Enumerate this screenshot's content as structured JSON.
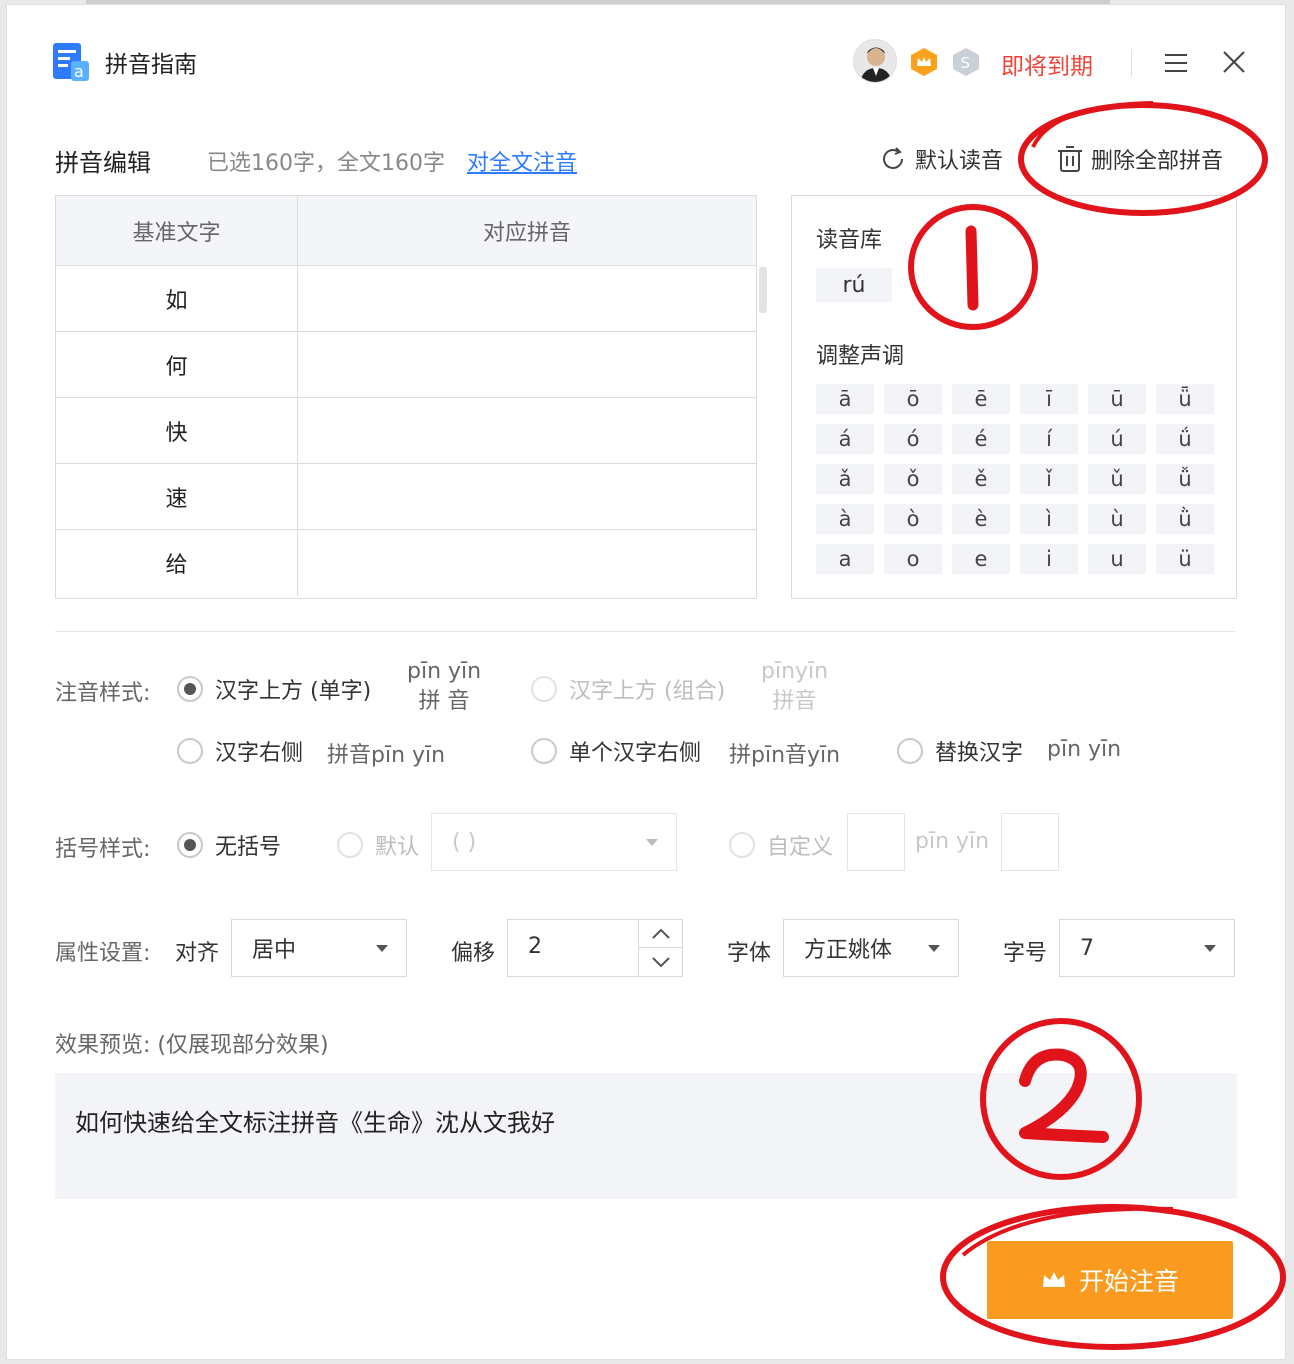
{
  "app": {
    "title": "拼音指南"
  },
  "header": {
    "expire_label": "即将到期"
  },
  "editor": {
    "title": "拼音编辑",
    "selection_info": "已选160字，全文160字",
    "annotate_all_link": "对全文注音",
    "default_reading_label": "默认读音",
    "delete_all_label": "删除全部拼音"
  },
  "table": {
    "headers": [
      "基准文字",
      "对应拼音"
    ],
    "rows": [
      {
        "char": "如",
        "pinyin": ""
      },
      {
        "char": "何",
        "pinyin": ""
      },
      {
        "char": "快",
        "pinyin": ""
      },
      {
        "char": "速",
        "pinyin": ""
      },
      {
        "char": "给",
        "pinyin": ""
      }
    ]
  },
  "reading_panel": {
    "library_label": "读音库",
    "readings": [
      "rú"
    ],
    "tone_label": "调整声调",
    "tones": [
      [
        "ā",
        "ō",
        "ē",
        "ī",
        "ū",
        "ǖ"
      ],
      [
        "á",
        "ó",
        "é",
        "í",
        "ú",
        "ǘ"
      ],
      [
        "ǎ",
        "ǒ",
        "ě",
        "ǐ",
        "ǔ",
        "ǚ"
      ],
      [
        "à",
        "ò",
        "è",
        "ì",
        "ù",
        "ǜ"
      ],
      [
        "a",
        "o",
        "e",
        "i",
        "u",
        "ü"
      ]
    ]
  },
  "annotation_style": {
    "label": "注音样式:",
    "options": [
      {
        "label": "汉字上方 (单字)",
        "checked": true,
        "enabled": true,
        "sample_top": "pīn yīn",
        "sample_bottom": "拼 音"
      },
      {
        "label": "汉字上方 (组合)",
        "checked": false,
        "enabled": false,
        "sample_top": "pīnyīn",
        "sample_bottom": "拼音"
      },
      {
        "label": "汉字右侧",
        "checked": false,
        "enabled": true,
        "sample": "拼音pīn yīn"
      },
      {
        "label": "单个汉字右侧",
        "checked": false,
        "enabled": true,
        "sample": "拼pīn音yīn"
      },
      {
        "label": "替换汉字",
        "checked": false,
        "enabled": true,
        "sample": "pīn yīn"
      }
    ]
  },
  "bracket_style": {
    "label": "括号样式:",
    "none_label": "无括号",
    "default_label": "默认",
    "default_select_value": "( )",
    "custom_label": "自定义",
    "custom_sample": "pīn yīn"
  },
  "properties": {
    "label": "属性设置:",
    "align_label": "对齐",
    "align_value": "居中",
    "offset_label": "偏移",
    "offset_value": "2",
    "font_label": "字体",
    "font_value": "方正姚体",
    "size_label": "字号",
    "size_value": "7"
  },
  "preview": {
    "label": "效果预览:  (仅展现部分效果)",
    "text": "如何快速给全文标注拼音《生命》沈从文我好"
  },
  "start_button": {
    "label": "开始注音"
  },
  "colors": {
    "accent": "#fa9a1f",
    "link": "#2f7bff",
    "warning": "#f0453a",
    "annotation": "#e0141a"
  }
}
